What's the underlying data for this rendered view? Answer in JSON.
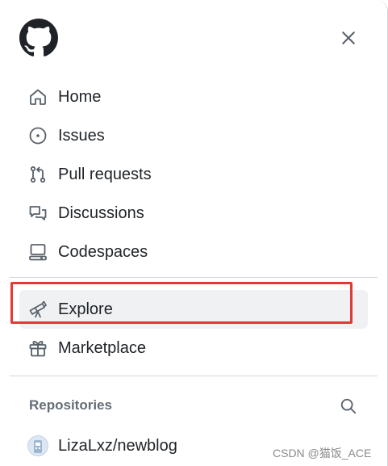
{
  "header": {
    "logo_icon": "github-mark-icon",
    "close_icon": "close-icon"
  },
  "nav": {
    "primary": [
      {
        "label": "Home",
        "icon": "home-icon"
      },
      {
        "label": "Issues",
        "icon": "issue-opened-icon"
      },
      {
        "label": "Pull requests",
        "icon": "git-pull-request-icon"
      },
      {
        "label": "Discussions",
        "icon": "comment-discussion-icon"
      },
      {
        "label": "Codespaces",
        "icon": "codespaces-icon"
      }
    ],
    "secondary": [
      {
        "label": "Explore",
        "icon": "telescope-icon",
        "highlighted": true
      },
      {
        "label": "Marketplace",
        "icon": "gift-icon"
      }
    ]
  },
  "repositories": {
    "heading": "Repositories",
    "search_icon": "search-icon",
    "items": [
      {
        "label": "LizaLxz/newblog",
        "icon": "repo-avatar"
      }
    ]
  },
  "watermark": "CSDN @猫饭_ACE",
  "colors": {
    "highlight": "#e53935",
    "active_bg": "#eff1f3",
    "text": "#1f2328",
    "muted": "#656d76",
    "border": "#d0d7de"
  }
}
